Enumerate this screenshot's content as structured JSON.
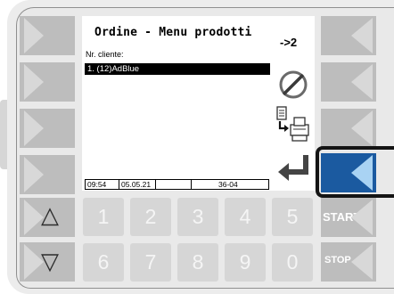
{
  "header": {
    "title": "Ordine - Menu prodotti",
    "page_indicator": "->2"
  },
  "form": {
    "customer_label": "Nr. cliente:",
    "selected_product": "1.  (12)AdBlue"
  },
  "status_bar": {
    "time": "09:54",
    "date": "05.05.21",
    "empty": "",
    "code": "36-04"
  },
  "keypad": {
    "row1": [
      "1",
      "2",
      "3",
      "4",
      "5"
    ],
    "row2": [
      "6",
      "7",
      "8",
      "9",
      "0"
    ]
  },
  "softkeys": {
    "up_symbol": "△",
    "down_symbol": "▽",
    "start_label": "START",
    "stop_label": "STOP"
  },
  "colors": {
    "active_key": "#1b5aa0",
    "active_key_arrow": "#a9d3f3",
    "selection_bg": "#000000"
  },
  "icons": {
    "cancel": "cancel-circle-icon",
    "print": "print-document-icon",
    "enter": "enter-arrow-icon"
  }
}
